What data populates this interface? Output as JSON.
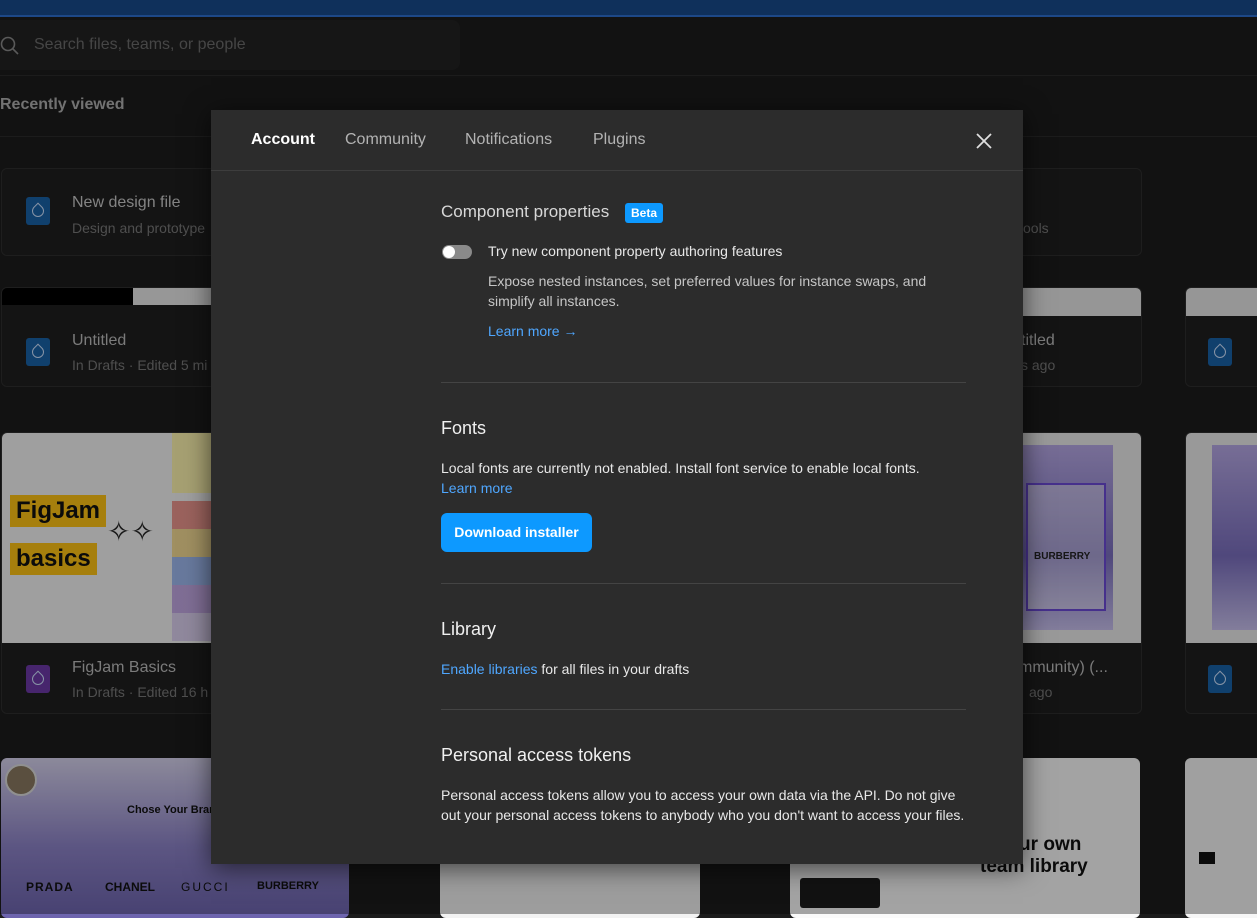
{
  "search": {
    "placeholder": "Search files, teams, or people"
  },
  "recently_viewed": "Recently viewed",
  "background_cards": {
    "new_design": {
      "title": "New design file",
      "subtitle": "Design and prototype"
    },
    "tools_fragment": "ools",
    "untitled": {
      "title": "Untitled",
      "subtitle": "In Drafts · Edited 5 mi"
    },
    "untitled_right": {
      "title": "titled",
      "subtitle": "s ago"
    },
    "figjam": {
      "title": "FigJam Basics",
      "subtitle": "In Drafts · Edited 16 h",
      "thumb_line1": "FigJam",
      "thumb_line2": "basics"
    },
    "community_right": {
      "title": "mmunity) (...",
      "subtitle": "ago"
    },
    "brand_thumb": {
      "heading": "Chose Your Brand",
      "brands": [
        "PRADA",
        "CHANEL",
        "GUCCI",
        "BURBERRY"
      ]
    },
    "library_thumb": {
      "line1": "d your own",
      "line2": "team library"
    },
    "burberry_thumb": "BURBERRY"
  },
  "modal": {
    "tabs": [
      {
        "label": "Account"
      },
      {
        "label": "Community"
      },
      {
        "label": "Notifications"
      },
      {
        "label": "Plugins"
      }
    ],
    "component_properties": {
      "title": "Component properties",
      "badge": "Beta",
      "toggle_label": "Try new component property authoring features",
      "toggle_on": false,
      "description": "Expose nested instances, set preferred values for instance swaps, and simplify all instances.",
      "learn_more": "Learn more →"
    },
    "fonts": {
      "title": "Fonts",
      "text": "Local fonts are currently not enabled. Install font service to enable local fonts.",
      "learn_more": "Learn more",
      "button": "Download installer"
    },
    "library": {
      "title": "Library",
      "link": "Enable libraries",
      "text": " for all files in your drafts"
    },
    "tokens": {
      "title": "Personal access tokens",
      "text": "Personal access tokens allow you to access your own data via the API. Do not give out your personal access tokens to anybody who you don't want to access your files."
    }
  },
  "colors": {
    "accent": "#0d99ff",
    "link": "#4fa7ff",
    "modal_bg": "#2c2c2c",
    "page_bg": "#1c1c1c"
  }
}
